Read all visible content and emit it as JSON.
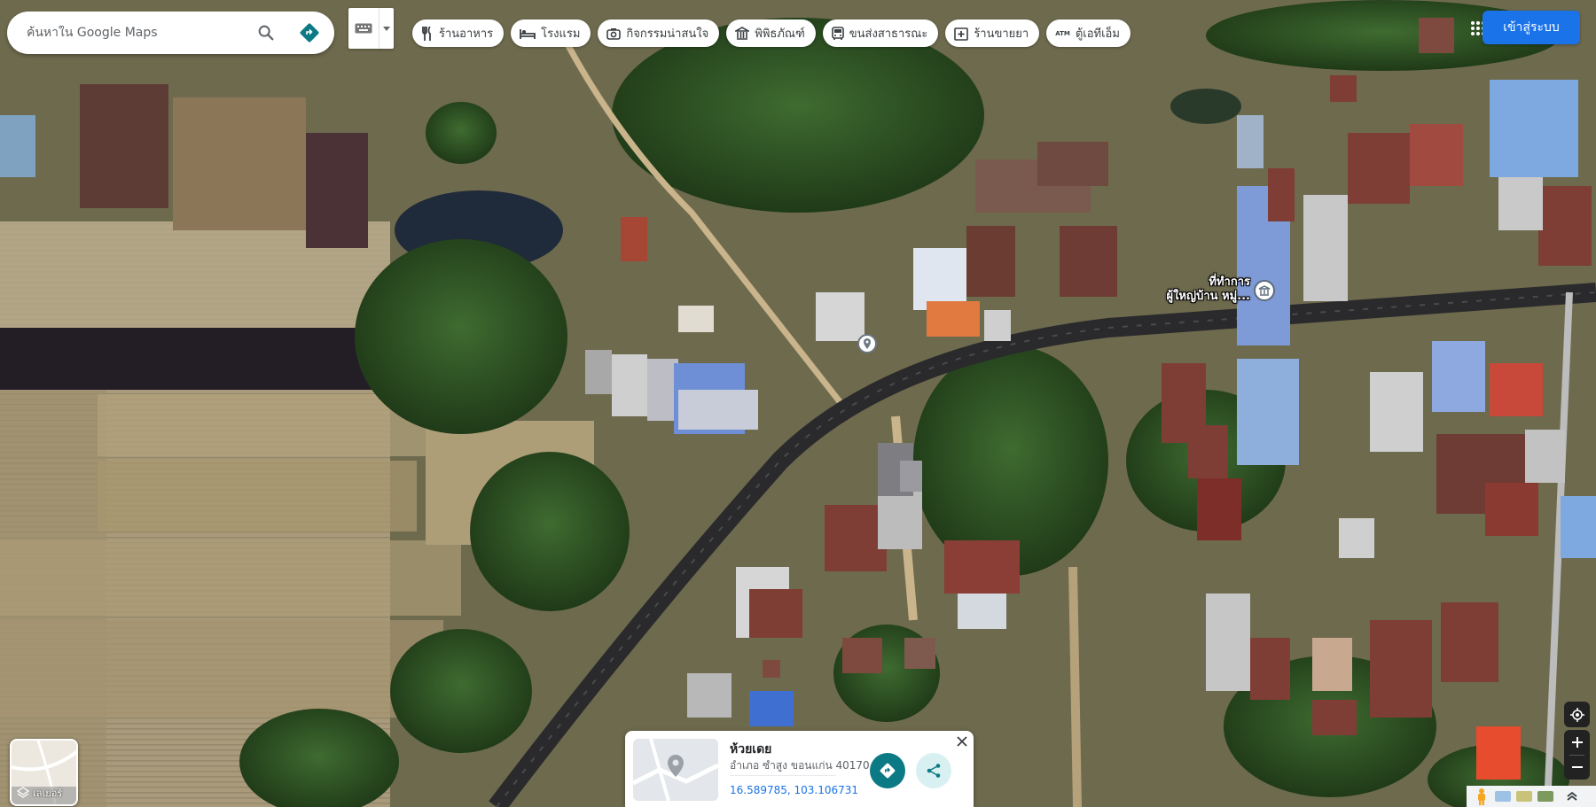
{
  "search": {
    "placeholder": "ค้นหาใน Google Maps"
  },
  "chips": [
    {
      "label": "ร้านอาหาร",
      "icon": "fork-knife-icon"
    },
    {
      "label": "โรงแรม",
      "icon": "bed-icon"
    },
    {
      "label": "กิจกรรมน่าสนใจ",
      "icon": "camera-icon"
    },
    {
      "label": "พิพิธภัณฑ์",
      "icon": "museum-icon"
    },
    {
      "label": "ขนส่งสาธารณะ",
      "icon": "bus-icon"
    },
    {
      "label": "ร้านขายยา",
      "icon": "pharmacy-icon"
    },
    {
      "label": "ตู้เอทีเอ็ม",
      "icon": "atm-icon"
    }
  ],
  "signin_label": "เข้าสู่ระบบ",
  "map_labels": {
    "poi_line1": "ที่ทำการ",
    "poi_line2": "ผู้ใหญ่บ้าน หมู่..."
  },
  "layers_label": "เลเยอร์",
  "place": {
    "name": "ห้วยเดย",
    "address": "อำเภอ ซำสูง ขอนแก่น 40170",
    "coords": "16.589785, 103.106731"
  },
  "colors": {
    "accent": "#1a73e8",
    "directions": "#0b7a85",
    "share_bg": "#d9f0f2"
  }
}
